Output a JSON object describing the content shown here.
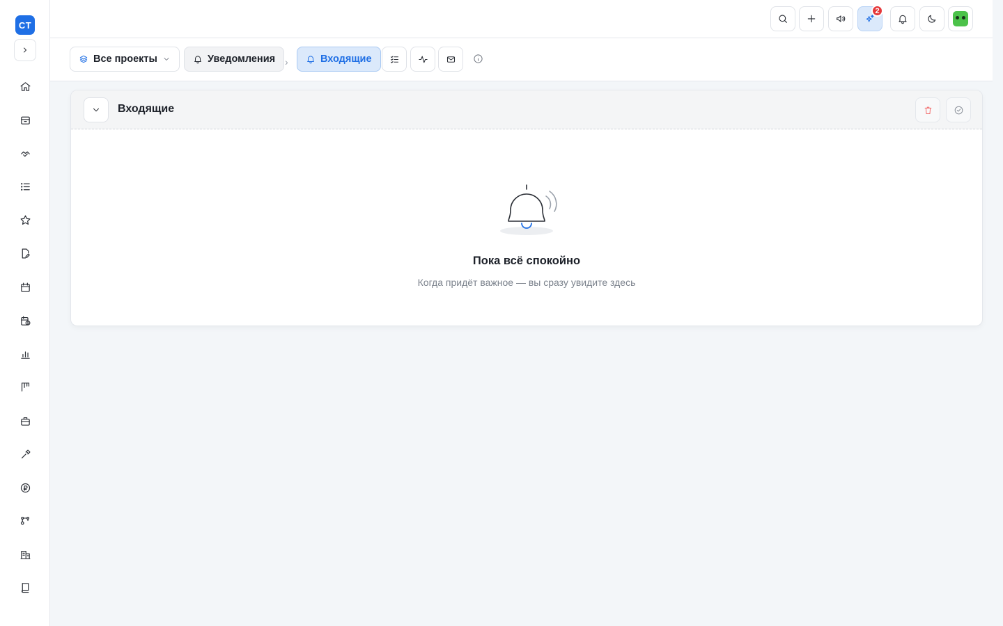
{
  "app": {
    "logo_text": "CT"
  },
  "sidebar": {
    "items": [
      {
        "name": "home"
      },
      {
        "name": "inbox"
      },
      {
        "name": "handshake"
      },
      {
        "name": "list"
      },
      {
        "name": "star"
      },
      {
        "name": "document-edit"
      },
      {
        "name": "calendar"
      },
      {
        "name": "calendar-clock"
      },
      {
        "name": "bar-chart"
      },
      {
        "name": "kanban"
      },
      {
        "name": "briefcase"
      },
      {
        "name": "tools"
      },
      {
        "name": "ruble"
      },
      {
        "name": "workflow"
      },
      {
        "name": "building"
      },
      {
        "name": "book"
      }
    ]
  },
  "topbar": {
    "notification_badge": "2",
    "buttons": [
      "search",
      "add",
      "announcements",
      "ai-assistant",
      "notifications",
      "theme",
      "avatar"
    ]
  },
  "subbar": {
    "projects_label": "Все проекты",
    "notifications_label": "Уведомления",
    "inbox_label": "Входящие"
  },
  "card": {
    "title": "Входящие",
    "empty_title": "Пока всё спокойно",
    "empty_subtitle": "Когда придёт важное — вы сразу увидите здесь"
  },
  "colors": {
    "accent": "#1f6fe5",
    "badge": "#e5383b",
    "delete": "#f26b6b"
  }
}
